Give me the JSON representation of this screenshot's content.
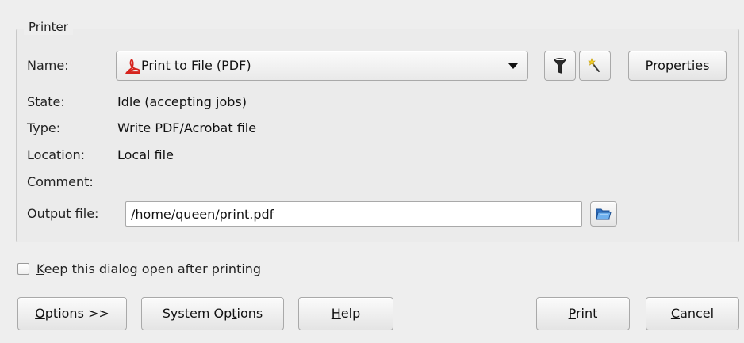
{
  "group": {
    "title": "Printer"
  },
  "printer": {
    "name_label_pre": "",
    "name_label_mn": "N",
    "name_label_post": "ame:",
    "selected": "Print to File (PDF)",
    "state_label": "State:",
    "state_value": "Idle (accepting jobs)",
    "type_label": "Type:",
    "type_value": "Write PDF/Acrobat file",
    "location_label": "Location:",
    "location_value": "Local file",
    "comment_label": "Comment:",
    "comment_value": "",
    "output_label_pre": "O",
    "output_label_mn": "u",
    "output_label_post": "tput file:",
    "output_value": "/home/queen/print.pdf",
    "filter_icon": "filter-funnel-icon",
    "wizard_icon": "magic-wand-icon",
    "browse_icon": "open-folder-icon",
    "pdf_icon": "pdf-document-icon"
  },
  "properties_button": {
    "pre": "P",
    "mn": "r",
    "post": "operties"
  },
  "keep_open": {
    "pre": "",
    "mn": "K",
    "post": "eep this dialog open after printing",
    "checked": false
  },
  "buttons": {
    "options": {
      "pre": "",
      "mn": "O",
      "post": "ptions >>"
    },
    "system_options": {
      "pre": "System Op",
      "mn": "t",
      "post": "ions"
    },
    "help": {
      "pre": "",
      "mn": "H",
      "post": "elp"
    },
    "print": {
      "pre": "",
      "mn": "P",
      "post": "rint"
    },
    "cancel": {
      "pre": "",
      "mn": "C",
      "post": "ancel"
    }
  },
  "colors": {
    "background": "#eeeeee",
    "pdf_red": "#d6241e",
    "folder_blue": "#3a7fd0"
  }
}
